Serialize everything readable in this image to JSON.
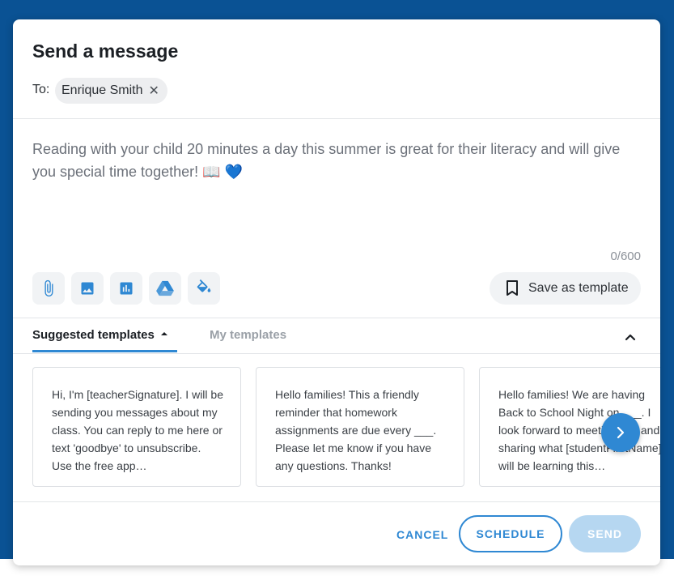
{
  "modal": {
    "title": "Send a message",
    "to_label": "To:",
    "recipient": "Enrique Smith",
    "remove_symbol": "✕"
  },
  "message": {
    "text": "Reading with your child 20 minutes a day this summer is great for their literacy and will give you special time together! 📖 💙",
    "counter": "0/600"
  },
  "toolbar": {
    "icons": [
      "paperclip-icon",
      "image-icon",
      "bar-chart-icon",
      "google-drive-icon",
      "paint-bucket-icon"
    ],
    "save_template_label": "Save as template"
  },
  "templates": {
    "tabs": [
      {
        "label": "Suggested templates",
        "active": true
      },
      {
        "label": "My templates",
        "active": false
      }
    ],
    "cards": [
      {
        "text": "Hi, I'm [teacherSignature]. I will be sending you messages about my class. You can reply to me here or text 'goodbye' to unsubscribe. Use the free app…"
      },
      {
        "text": "Hello families! This a friendly reminder that homework assignments are due every ___. Please let me know if you have any questions. Thanks!"
      },
      {
        "text": "Hello families! We are having Back to School Night on ___. I look forward to meeting you and sharing what [studentFirstName] will be learning this…"
      }
    ]
  },
  "footer": {
    "cancel_label": "CANCEL",
    "schedule_label": "SCHEDULE",
    "send_label": "SEND"
  },
  "colors": {
    "accent": "#2f88d3",
    "background": "#0a5294",
    "send_disabled": "#b6d7f1"
  }
}
